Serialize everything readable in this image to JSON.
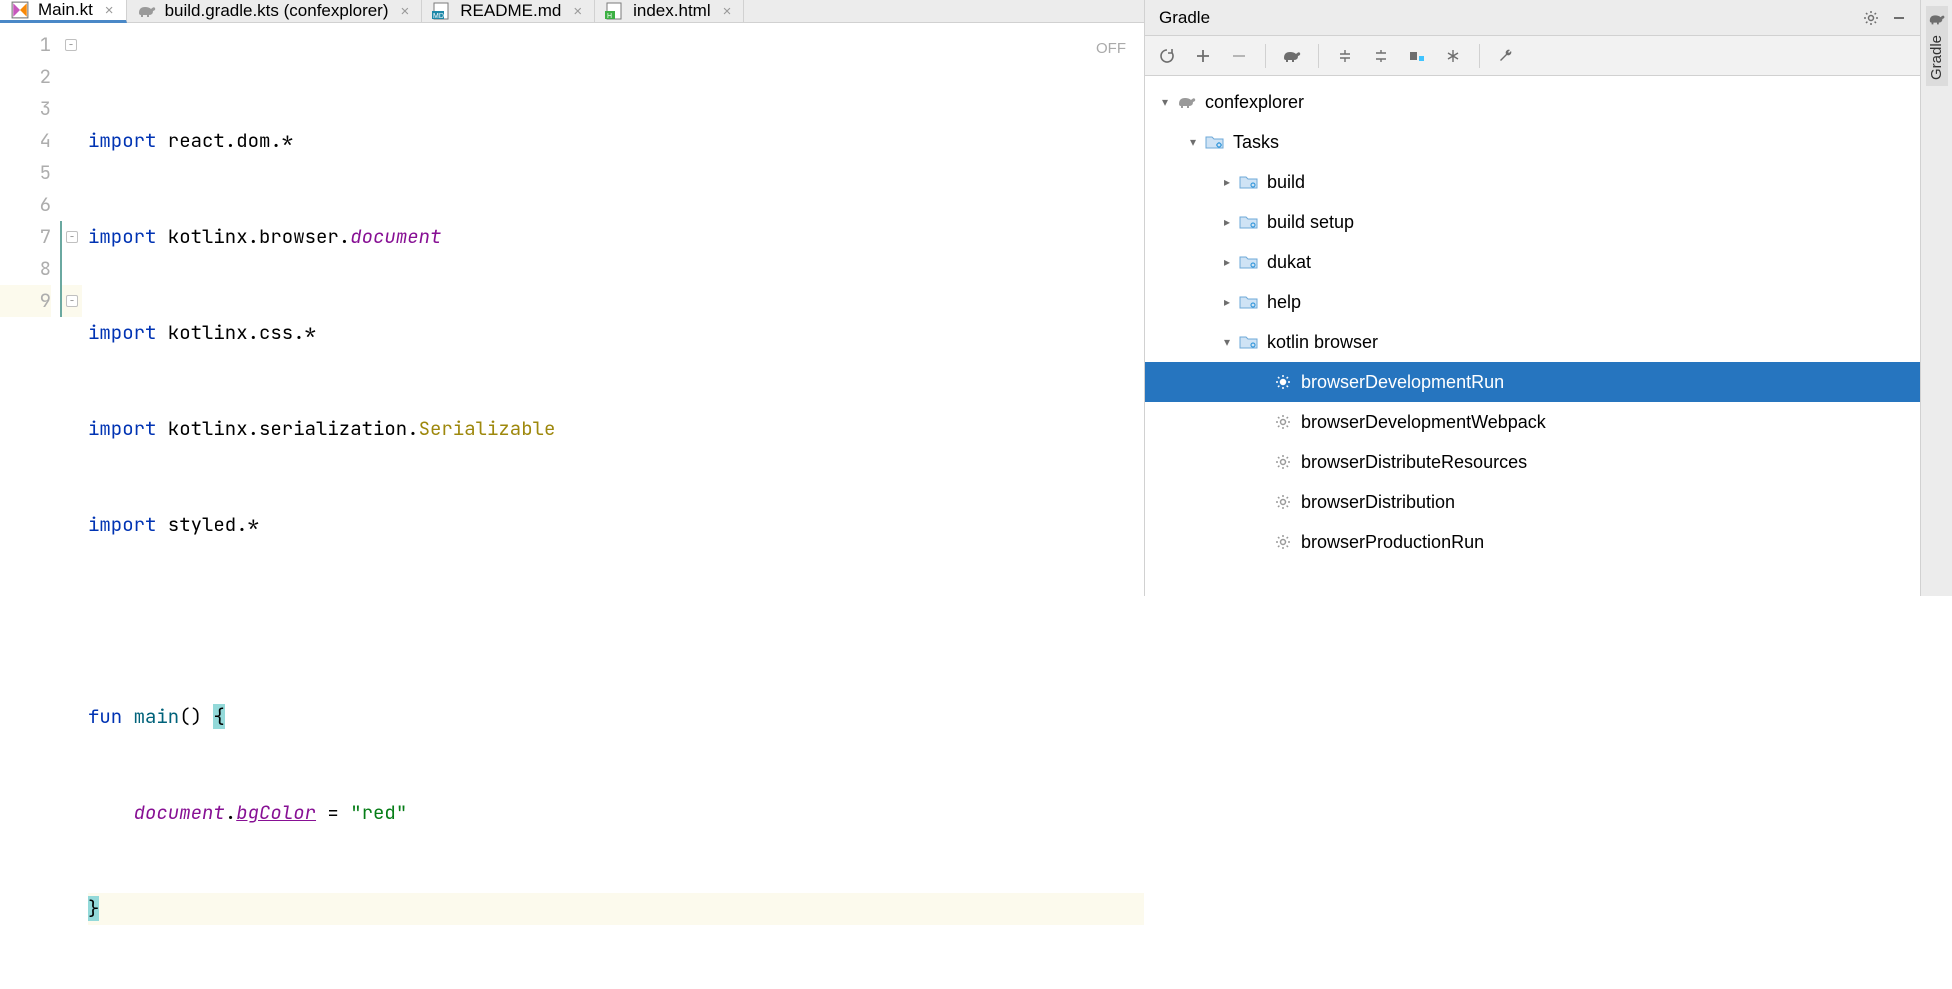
{
  "tabs": [
    {
      "label": "Main.kt",
      "icon": "kotlin-file-icon",
      "active": true
    },
    {
      "label": "build.gradle.kts (confexplorer)",
      "icon": "gradle-elephant-icon",
      "active": false
    },
    {
      "label": "README.md",
      "icon": "markdown-file-icon",
      "active": false
    },
    {
      "label": "index.html",
      "icon": "html-file-icon",
      "active": false
    }
  ],
  "editor": {
    "status_indicator": "OFF",
    "lines": [
      "1",
      "2",
      "3",
      "4",
      "5",
      "6",
      "7",
      "8",
      "9"
    ],
    "code": {
      "l1_kw": "import",
      "l1_pkg": " react.dom.*",
      "l2_kw": "import",
      "l2_pkg": " kotlinx.browser.",
      "l2_id": "document",
      "l3_kw": "import",
      "l3_pkg": " kotlinx.css.*",
      "l4_kw": "import",
      "l4_pkg": " kotlinx.serialization.",
      "l4_id": "Serializable",
      "l5_kw": "import",
      "l5_pkg": " styled.*",
      "l7_kw": "fun ",
      "l7_fn": "main",
      "l7_rest": "() ",
      "l7_brace": "{",
      "l8_indent": "    ",
      "l8_doc": "document",
      "l8_dot": ".",
      "l8_prop": "bgColor",
      "l8_eq": " = ",
      "l8_str": "\"red\"",
      "l9_brace": "}"
    }
  },
  "gradle": {
    "title": "Gradle",
    "toolbar": [
      "refresh",
      "add",
      "remove",
      "sep",
      "elephant",
      "expand",
      "collapse",
      "show",
      "offline",
      "sep",
      "wrench"
    ],
    "tree": {
      "root": "confexplorer",
      "tasks_label": "Tasks",
      "groups": [
        {
          "label": "build",
          "expanded": false
        },
        {
          "label": "build setup",
          "expanded": false
        },
        {
          "label": "dukat",
          "expanded": false
        },
        {
          "label": "help",
          "expanded": false
        }
      ],
      "kotlin_browser_label": "kotlin browser",
      "tasks": [
        {
          "label": "browserDevelopmentRun",
          "selected": true
        },
        {
          "label": "browserDevelopmentWebpack",
          "selected": false
        },
        {
          "label": "browserDistributeResources",
          "selected": false
        },
        {
          "label": "browserDistribution",
          "selected": false
        },
        {
          "label": "browserProductionRun",
          "selected": false
        }
      ]
    }
  },
  "right_tab_label": "Gradle"
}
